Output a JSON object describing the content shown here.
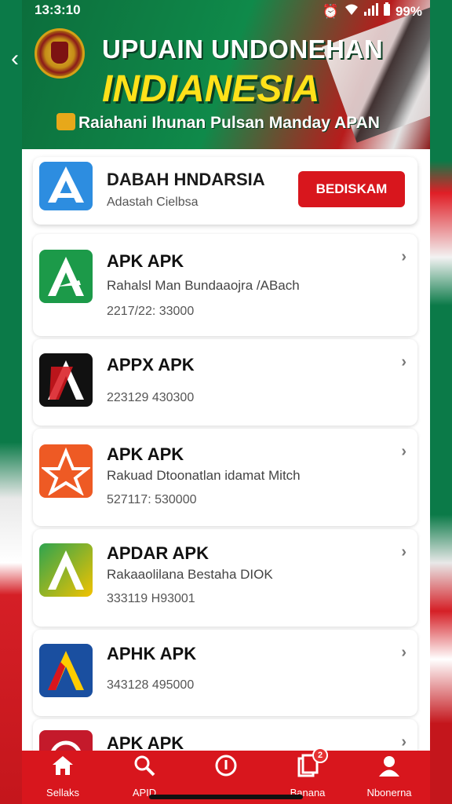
{
  "status_bar": {
    "time": "13:3:10",
    "battery": "99%"
  },
  "banner": {
    "title": "UPUAIN UNDONEHAN",
    "subtitle": "INDIANESIA",
    "tagline": "Raiahani Ihunan Pulsan Manday APAN"
  },
  "featured": {
    "name": "DABAH HNDARSIA",
    "sub": "Adastah Cielbsa",
    "button": "BEDISKAM"
  },
  "apps": [
    {
      "title": "APK APK",
      "desc": "Rahalsl Man Bundaaojra /ABach",
      "meta": "2217/22: 33000"
    },
    {
      "title": "APPX APK",
      "desc": "",
      "meta": "223129  430300"
    },
    {
      "title": "APK APK",
      "desc": "Rakuad Dtoonatlan idamat Mitch",
      "meta": "527117: 530000"
    },
    {
      "title": "APDAR APK",
      "desc": "Rakaaolilana Bestaha DIOK",
      "meta": "333119  H93001"
    },
    {
      "title": "APHK APK",
      "desc": "",
      "meta": "343128  495000"
    },
    {
      "title": "APK APK",
      "desc": "",
      "meta": ""
    }
  ],
  "nav": {
    "items": [
      {
        "label": "Sellaks",
        "icon": "home-icon"
      },
      {
        "label": "APID",
        "icon": "search-icon"
      },
      {
        "label": "",
        "icon": "info-icon"
      },
      {
        "label": "Banana",
        "icon": "files-icon",
        "badge": "2"
      },
      {
        "label": "Nbonerna",
        "icon": "profile-icon"
      }
    ]
  },
  "colors": {
    "primary": "#d8161d",
    "green": "#0f8a4a",
    "accent_yellow": "#ffe11a"
  }
}
